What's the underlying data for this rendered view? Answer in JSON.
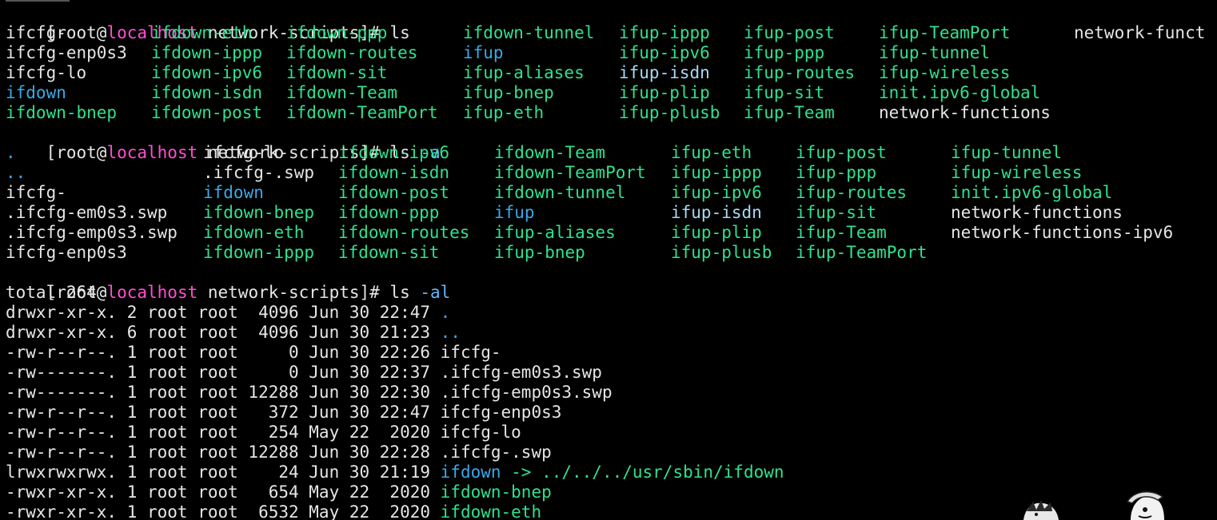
{
  "theme": {
    "background": "#000000",
    "text": "#e6e6e6",
    "executable": "#2ee28e",
    "directory_link": "#3aa8e8",
    "hostname": "#ff4fd0",
    "argument": "#5fb8ff"
  },
  "prompt": {
    "open": "[root@",
    "host": "localhost",
    "rest": " network-scripts]# "
  },
  "commands": {
    "ls": "ls",
    "ls_a_cmd": "ls ",
    "ls_a_arg": "-a",
    "ls_al_cmd": "ls ",
    "ls_al_arg": "-al"
  },
  "ls_rows": [
    [
      "ifcfg-",
      "ifdown-eth",
      "ifdown-ppp",
      "ifdown-tunnel",
      "ifup-ippp",
      "ifup-post",
      "ifup-TeamPort",
      "network-funct"
    ],
    [
      "ifcfg-enp0s3",
      "ifdown-ippp",
      "ifdown-routes",
      "ifup",
      "ifup-ipv6",
      "ifup-ppp",
      "ifup-tunnel",
      ""
    ],
    [
      "ifcfg-lo",
      "ifdown-ipv6",
      "ifdown-sit",
      "ifup-aliases",
      "ifup-isdn",
      "ifup-routes",
      "ifup-wireless",
      ""
    ],
    [
      "ifdown",
      "ifdown-isdn",
      "ifdown-Team",
      "ifup-bnep",
      "ifup-plip",
      "ifup-sit",
      "init.ipv6-global",
      ""
    ],
    [
      "ifdown-bnep",
      "ifdown-post",
      "ifdown-TeamPort",
      "ifup-eth",
      "ifup-plusb",
      "ifup-Team",
      "network-functions",
      ""
    ]
  ],
  "ls_a_rows": [
    [
      ".",
      "ifcfg-lo",
      "ifdown-ipv6",
      "ifdown-Team",
      "ifup-eth",
      "ifup-post",
      "ifup-tunnel"
    ],
    [
      "..",
      ".ifcfg-.swp",
      "ifdown-isdn",
      "ifdown-TeamPort",
      "ifup-ippp",
      "ifup-ppp",
      "ifup-wireless"
    ],
    [
      "ifcfg-",
      "ifdown",
      "ifdown-post",
      "ifdown-tunnel",
      "ifup-ipv6",
      "ifup-routes",
      "init.ipv6-global"
    ],
    [
      ".ifcfg-em0s3.swp",
      "ifdown-bnep",
      "ifdown-ppp",
      "ifup",
      "ifup-isdn",
      "ifup-sit",
      "network-functions"
    ],
    [
      ".ifcfg-emp0s3.swp",
      "ifdown-eth",
      "ifdown-routes",
      "ifup-aliases",
      "ifup-plip",
      "ifup-Team",
      "network-functions-ipv6"
    ],
    [
      "ifcfg-enp0s3",
      "ifdown-ippp",
      "ifdown-sit",
      "ifup-bnep",
      "ifup-plusb",
      "ifup-TeamPort",
      ""
    ]
  ],
  "total_line": "total 264",
  "ls_al_rows": [
    {
      "meta": "drwxr-xr-x. 2 root root  4096 Jun 30 22:47 ",
      "name": ".",
      "link": ""
    },
    {
      "meta": "drwxr-xr-x. 6 root root  4096 Jun 30 21:23 ",
      "name": "..",
      "link": ""
    },
    {
      "meta": "-rw-r--r--. 1 root root     0 Jun 30 22:26 ",
      "name": "ifcfg-",
      "link": ""
    },
    {
      "meta": "-rw-------. 1 root root     0 Jun 30 22:37 ",
      "name": ".ifcfg-em0s3.swp",
      "link": ""
    },
    {
      "meta": "-rw-------. 1 root root 12288 Jun 30 22:30 ",
      "name": ".ifcfg-emp0s3.swp",
      "link": ""
    },
    {
      "meta": "-rw-r--r--. 1 root root   372 Jun 30 22:47 ",
      "name": "ifcfg-enp0s3",
      "link": ""
    },
    {
      "meta": "-rw-r--r--. 1 root root   254 May 22  2020 ",
      "name": "ifcfg-lo",
      "link": ""
    },
    {
      "meta": "-rw-r--r--. 1 root root 12288 Jun 30 22:28 ",
      "name": ".ifcfg-.swp",
      "link": ""
    },
    {
      "meta": "lrwxrwxrwx. 1 root root    24 Jun 30 21:19 ",
      "name": "ifdown",
      "link": " -> ../../../usr/sbin/ifdown"
    },
    {
      "meta": "-rwxr-xr-x. 1 root root   654 May 22  2020 ",
      "name": "ifdown-bnep",
      "link": ""
    },
    {
      "meta": "-rwxr-xr-x. 1 root root  6532 May 22  2020 ",
      "name": "ifdown-eth",
      "link": ""
    }
  ]
}
